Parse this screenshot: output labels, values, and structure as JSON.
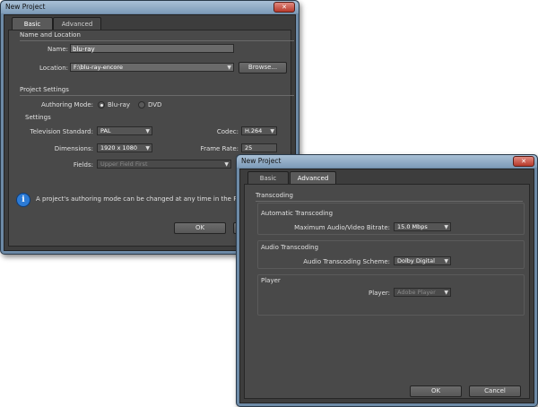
{
  "back_dialog": {
    "title": "New Project",
    "close_glyph": "✕",
    "tabs": [
      "Basic",
      "Advanced"
    ],
    "name_location": {
      "heading": "Name and Location",
      "name_label": "Name:",
      "name_value": "blu-ray",
      "location_label": "Location:",
      "location_value": "F:\\blu-ray-encore",
      "browse_label": "Browse..."
    },
    "project_settings": {
      "heading": "Project Settings",
      "authoring_mode_label": "Authoring Mode:",
      "mode_bluray": "Blu-ray",
      "mode_dvd": "DVD",
      "selected_mode": "Blu-ray"
    },
    "settings": {
      "heading": "Settings",
      "tv_standard_label": "Television Standard:",
      "tv_standard_value": "PAL",
      "codec_label": "Codec:",
      "codec_value": "H.264",
      "dimensions_label": "Dimensions:",
      "dimensions_value": "1920 x 1080",
      "frame_rate_label": "Frame Rate:",
      "frame_rate_value": "25",
      "fields_label": "Fields:",
      "fields_value": "Upper Field First"
    },
    "info_text": "A project's authoring mode can be changed at any time in the Project Settings",
    "ok_label": "OK"
  },
  "front_dialog": {
    "title": "New Project",
    "close_glyph": "✕",
    "tabs": [
      "Basic",
      "Advanced"
    ],
    "transcoding_heading": "Transcoding",
    "automatic": {
      "heading": "Automatic Transcoding",
      "bitrate_label": "Maximum Audio/Video Bitrate:",
      "bitrate_value": "15.0 Mbps"
    },
    "audio": {
      "heading": "Audio Transcoding",
      "scheme_label": "Audio Transcoding Scheme:",
      "scheme_value": "Dolby Digital"
    },
    "player": {
      "heading": "Player",
      "player_label": "Player:",
      "player_value": "Adobe Player"
    },
    "ok_label": "OK",
    "cancel_label": "Cancel"
  },
  "icons": {
    "info": "i",
    "dropdown": "▼"
  }
}
